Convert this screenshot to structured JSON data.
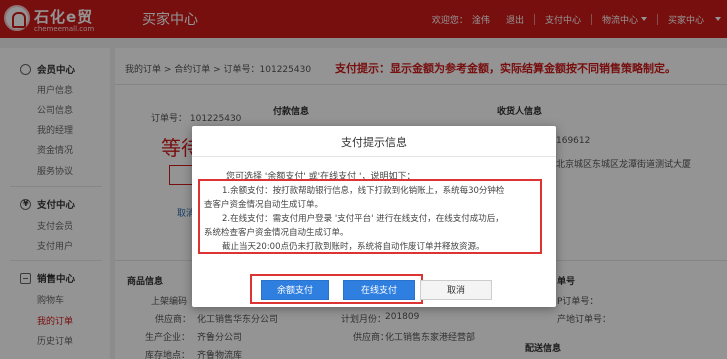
{
  "header": {
    "logo_text": "石化e贸",
    "logo_domain": "chemeemall.com",
    "center_title": "买家中心",
    "welcome": "欢迎您：",
    "username": "淦伟",
    "logout": "退出",
    "payment_center": "支付中心",
    "logistics_center": "物流中心",
    "buyer_center": "买家中心"
  },
  "sidebar": {
    "member_center": {
      "title": "会员中心",
      "items": [
        "用户信息",
        "公司信息",
        "我的经理",
        "资金情况",
        "服务协议"
      ]
    },
    "payment_center": {
      "title": "支付中心",
      "items": [
        "支付会员",
        "支付用户"
      ]
    },
    "sales_center": {
      "title": "销售中心",
      "items": [
        "购物车",
        "我的订单",
        "历史订单"
      ],
      "active": "我的订单"
    }
  },
  "main": {
    "breadcrumb": "我的订单 > 合约订单 > 订单号：101225430",
    "pay_tip": "支付提示：显示金额为参考金额，实际结算金额按不同销售策略制定。",
    "order_no": "订单号： 101225430",
    "status_partial": "等待",
    "cancel_partial": "取消",
    "payment_info": "付款信息",
    "receiver_info": "收货人信息",
    "phone_partial": "169612",
    "address_partial": "北京城区东城区龙潭街道测试大厦",
    "product_info": "商品信息",
    "shelf_code_label": "上架编码",
    "supplier_label": "供应商：",
    "supplier_value": "化工销售华东分公司",
    "producer_label": "生产企业：",
    "producer_value": "齐鲁分公司",
    "warehouse_label": "库存地点：",
    "warehouse_value": "齐鲁物流库",
    "plan_month_label": "计划月份：",
    "plan_month_value": "201809",
    "supplier2_label": "供应商：",
    "supplier2_value": "化工销售东家港经营部",
    "doc_no_partial": "单号",
    "doc_no2_partial": "P订单号：",
    "producer_partial": "产地订单号：",
    "delivery_info": "配送信息"
  },
  "dialog": {
    "title": "支付提示信息",
    "intro": "您可选择 '余额支付' 或'在线支付 '，说明如下：",
    "lines": [
      "1.余额支付：按打款帮助银行信息，线下打款到化销账上，系统每30分钟检",
      "查客户资金情况自动生成订单。",
      "2.在线支付：需支付用户登录 '支付平台' 进行在线支付，在线支付成功后，",
      "系统检查客户资金情况自动生成订单。",
      "截止当天20:00点仍未打款到账时，系统将自动作废订单并释放资源。"
    ],
    "btn_balance": "余额支付",
    "btn_online": "在线支付",
    "btn_cancel": "取消"
  },
  "colors": {
    "brand_red": "#cf1a1b",
    "primary_blue": "#2f7fe0",
    "highlight_red": "#d33333"
  }
}
